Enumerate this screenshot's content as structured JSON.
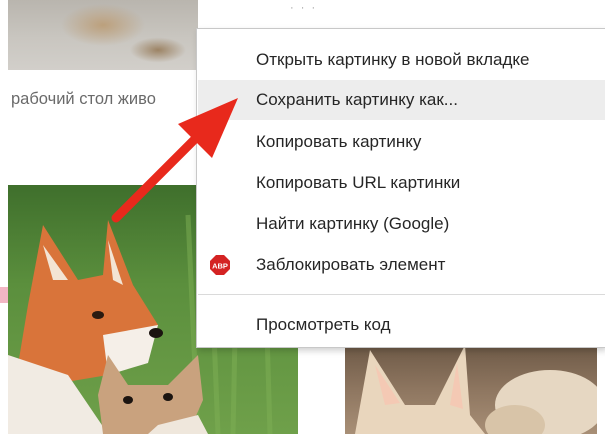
{
  "page": {
    "image_caption": "рабочий стол живо"
  },
  "context_menu": {
    "items": [
      {
        "label": "Открыть картинку в новой вкладке"
      },
      {
        "label": "Сохранить картинку как..."
      },
      {
        "label": "Копировать картинку"
      },
      {
        "label": "Копировать URL картинки"
      },
      {
        "label": "Найти картинку (Google)"
      },
      {
        "label": "Заблокировать элемент",
        "icon": "adblock-plus-icon",
        "icon_text": "ABP"
      },
      {
        "label": "Просмотреть код"
      }
    ],
    "highlighted_item": "Сохранить картинку как...",
    "highlight_color": "#ededed"
  },
  "annotation": {
    "arrow_color": "#e8291c"
  },
  "colors": {
    "abp_red": "#d42323"
  }
}
